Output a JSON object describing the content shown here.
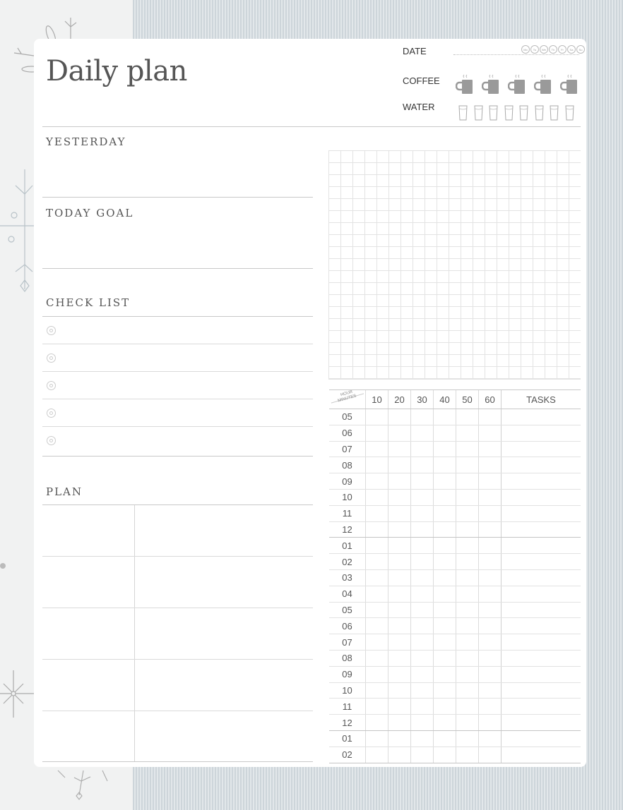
{
  "header": {
    "title": "Daily plan",
    "date_label": "DATE",
    "coffee_label": "COFFEE",
    "water_label": "WATER",
    "weekdays": [
      "Mo",
      "Tu",
      "We",
      "Th",
      "Fr",
      "Sa",
      "Su"
    ],
    "coffee_cups": 5,
    "water_glasses": 8
  },
  "sections": {
    "yesterday": "YESTERDAY",
    "today_goal": "TODAY GOAL",
    "check_list": "CHECK LIST",
    "plan": "PLAN"
  },
  "checklist": {
    "items": 5
  },
  "plan": {
    "rows": 5
  },
  "schedule": {
    "corner_top": "HOUR",
    "corner_bottom": "MINUTES",
    "minute_columns": [
      "10",
      "20",
      "30",
      "40",
      "50",
      "60"
    ],
    "tasks_label": "TASKS",
    "hours": [
      "05",
      "06",
      "07",
      "08",
      "09",
      "10",
      "11",
      "12",
      "01",
      "02",
      "03",
      "04",
      "05",
      "06",
      "07",
      "08",
      "09",
      "10",
      "11",
      "12",
      "01",
      "02"
    ]
  },
  "colors": {
    "text": "#555555",
    "rule": "#c8c8c8",
    "cup": "#9a9a9a"
  }
}
